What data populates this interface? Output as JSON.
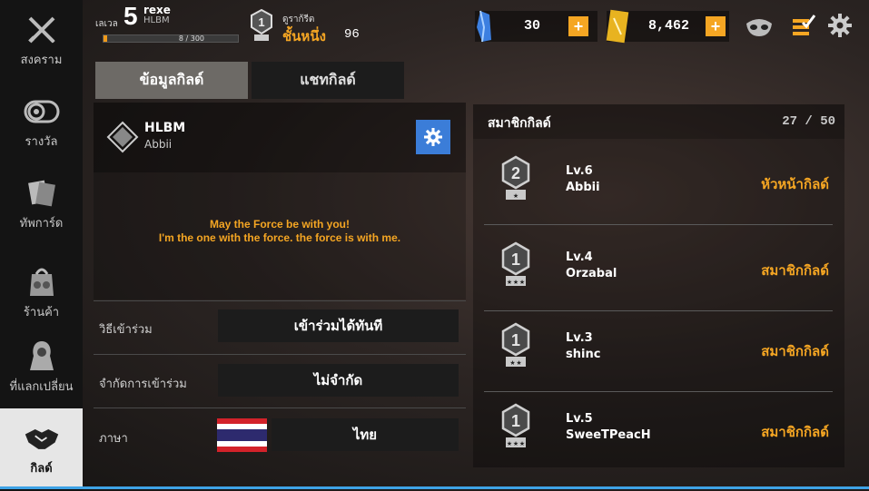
{
  "sidebar": {
    "items": [
      {
        "label": "สงคราม",
        "icon": "crossed-swords-icon"
      },
      {
        "label": "รางวัล",
        "icon": "reward-icon"
      },
      {
        "label": "ทัพการ์ด",
        "icon": "card-deck-icon"
      },
      {
        "label": "ร้านค้า",
        "icon": "shop-icon"
      },
      {
        "label": "ที่แลกเปลี่ยน",
        "icon": "exchange-icon"
      },
      {
        "label": "กิลด์",
        "icon": "handshake-icon"
      }
    ]
  },
  "player": {
    "level_label": "เลเวล",
    "level": "5",
    "name": "rexe",
    "guild_tag": "HLBM",
    "xp_text": "8 / 300",
    "xp_progress": 0.027,
    "rank_label": "ดูราก้รีต",
    "rank_name": "ชั้นหนึ่ง",
    "rank_points": "96"
  },
  "currency": {
    "crystals": "30",
    "gold": "8,462"
  },
  "tabs": {
    "info": "ข้อมูลกิลด์",
    "chat": "แชทกิลด์"
  },
  "guild": {
    "name": "HLBM",
    "leader": "Abbii",
    "message_line1": "May the Force be with you!",
    "message_line2": "I'm the one with the force. the force is with me."
  },
  "settings_rows": {
    "join_label": "วิธีเข้าร่วม",
    "join_value": "เข้าร่วมได้ทันที",
    "limit_label": "จำกัดการเข้าร่วม",
    "limit_value": "ไม่จำกัด",
    "lang_label": "ภาษา",
    "lang_value": "ไทย"
  },
  "members": {
    "title": "สมาชิกกิลด์",
    "count": "27 / 50",
    "list": [
      {
        "level": "Lv.6",
        "name": "Abbii",
        "role": "หัวหน้ากิลด์",
        "badge_num": "2",
        "stars": 1
      },
      {
        "level": "Lv.4",
        "name": "Orzabal",
        "role": "สมาชิกกิลด์",
        "badge_num": "1",
        "stars": 3
      },
      {
        "level": "Lv.3",
        "name": "shinc",
        "role": "สมาชิกกิลด์",
        "badge_num": "1",
        "stars": 2
      },
      {
        "level": "Lv.5",
        "name": "SweeTPeacH",
        "role": "สมาชิกกิลด์",
        "badge_num": "1",
        "stars": 3
      }
    ]
  },
  "colors": {
    "accent": "#f5a623",
    "button_blue": "#3b7dd8",
    "highlight_line": "#3ea3e6"
  }
}
